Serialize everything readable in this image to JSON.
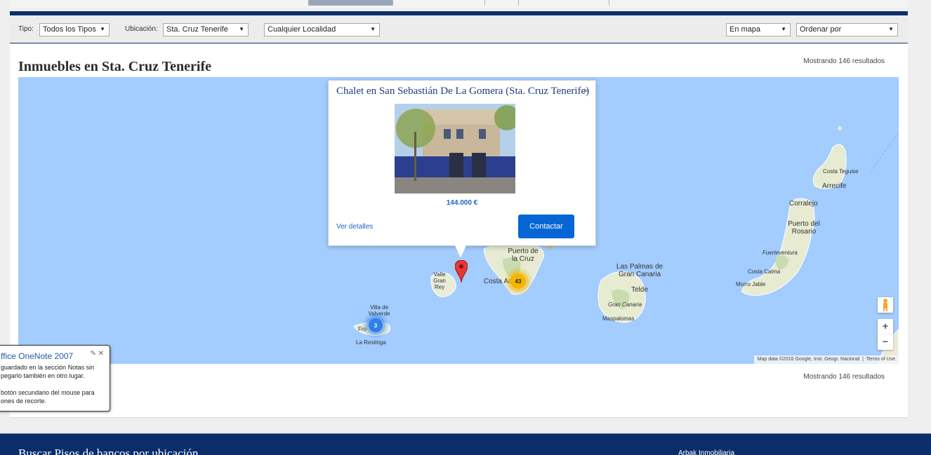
{
  "filters": {
    "tipo_label": "Tipo:",
    "tipo_value": "Todos los Tipos",
    "ubicacion_label": "Ubicación:",
    "ubicacion_value": "Sta. Cruz Tenerife",
    "localidad_value": "Cualquier Localidad",
    "view_value": "En mapa",
    "order_value": "Ordenar por"
  },
  "panel": {
    "title": "Inmuebles en Sta. Cruz Tenerife",
    "results_text": "Mostrando 146 resultados"
  },
  "popup": {
    "title": "Chalet en San Sebastián De La Gomera (Sta. Cruz Tenerife)",
    "price": "144.000 €",
    "details_link": "Ver detalles",
    "contact_button": "Contactar",
    "close_icon": "×"
  },
  "map": {
    "places": {
      "costa_teguise": "Costa Teguise",
      "arrecife": "Arrecife",
      "corralejo": "Corralejo",
      "puerto_rosario": "Puerto del Rosario",
      "fuerteventura": "Fuerteventura",
      "costa_calma": "Costa Calma",
      "morro_jable": "Morro Jable",
      "las_palmas": "Las Palmas de Gran Canaria",
      "telde": "Telde",
      "gran_canaria": "Gran Canaria",
      "maspalomas": "Maspalomas",
      "puerto_cruz": "Puerto de la Cruz",
      "costa_adeje": "Costa Ac",
      "valle_gran_rey": "Valle Gran Rey",
      "valverde": "Villa de Valverde",
      "frontera": "Fro",
      "la_restinga": "La Restinga"
    },
    "clusters": {
      "hierro_count": "3",
      "tenerife_count": "43"
    },
    "zoom_in": "+",
    "zoom_out": "−",
    "attribution": "Map data ©2016 Google, Inst. Geogr. Nacional",
    "terms": "Terms of Use"
  },
  "onenote": {
    "title": "ffice OneNote 2007",
    "text": "guardado en la sección Notas sin\npegarlo también en otro lugar.\n\nbotón secundario del mouse para\nones de recorte."
  },
  "footer": {
    "title": "Buscar Pisos de bancos por ubicación",
    "right_text": "Arbak Inmobiliaria"
  },
  "colors": {
    "navy": "#0b2e6a",
    "map_water": "#a3ccff",
    "accent_blue": "#0766d6",
    "cluster_orange": "#f6b400",
    "cluster_blue": "#2e7fe8"
  }
}
